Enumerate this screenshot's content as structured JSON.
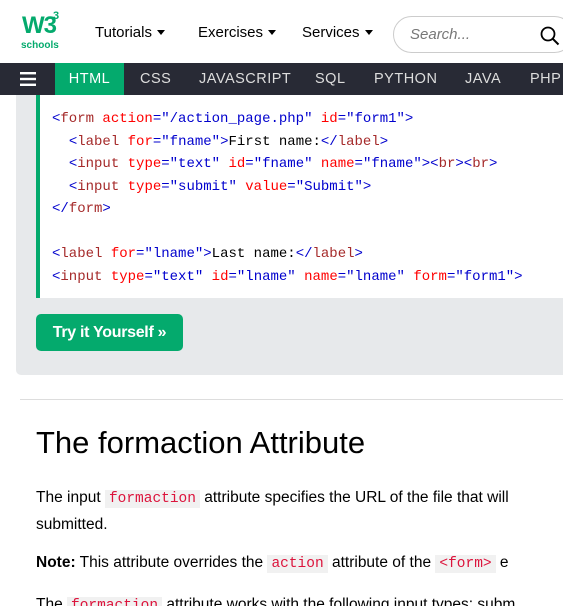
{
  "header": {
    "logo": {
      "text": "W3",
      "sup": "3",
      "sub": "schools"
    },
    "menu": [
      {
        "label": "Tutorials"
      },
      {
        "label": "Exercises"
      },
      {
        "label": "Services"
      }
    ],
    "search_placeholder": "Search..."
  },
  "langnav": {
    "items": [
      "HTML",
      "CSS",
      "JAVASCRIPT",
      "SQL",
      "PYTHON",
      "JAVA",
      "PHP"
    ],
    "active": "HTML"
  },
  "example": {
    "try_button": "Try it Yourself »"
  },
  "article": {
    "title": "The formaction Attribute",
    "p1_a": "The input ",
    "p1_code": "formaction",
    "p1_b": " attribute specifies the URL of the file that will",
    "p1_line2": "submitted.",
    "p2_note": "Note:",
    "p2_a": " This attribute overrides the ",
    "p2_code1": "action",
    "p2_b": " attribute of the ",
    "p2_code2": "<form>",
    "p2_c": " e",
    "p3_a": "The ",
    "p3_code": "formaction",
    "p3_b": " attribute works with the following input types: subm"
  },
  "colors": {
    "brand": "#04AA6D",
    "nav_bg": "#282A35",
    "example_bg": "#E7E9EB"
  }
}
